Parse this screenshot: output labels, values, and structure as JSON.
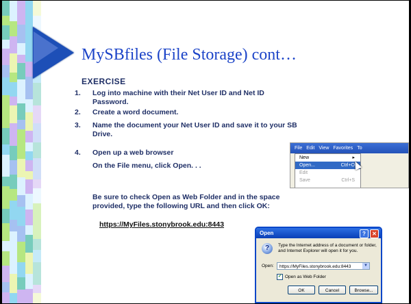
{
  "slide": {
    "title": "MySBfiles (File Storage) cont…",
    "exercise_heading": "EXERCISE",
    "steps": [
      {
        "num": "1.",
        "text": [
          "Log into machine with their Net User ID and Net ID",
          "Password."
        ]
      },
      {
        "num": "2.",
        "text": [
          "Create a word document."
        ]
      },
      {
        "num": "3.",
        "text": [
          "Name the document your Net User ID and save it to your SB",
          "Drive."
        ]
      },
      {
        "num": "4.",
        "text": [
          "Open up a web browser",
          "On the File menu, click Open. . ."
        ]
      }
    ],
    "note_lines": [
      "Be sure to check Open as Web Folder and in the space",
      "provided, type the following URL and then click OK:"
    ],
    "url": "https://MyFiles.stonybrook.edu:8443"
  },
  "menu_screenshot": {
    "menubar": [
      "File",
      "Edit",
      "View",
      "Favorites",
      "To"
    ],
    "items": [
      {
        "label": "New",
        "shortcut": "▸",
        "state": "normal"
      },
      {
        "label": "Open...",
        "shortcut": "Ctrl+O",
        "state": "selected"
      },
      {
        "label": "Edit",
        "shortcut": "",
        "state": "disabled"
      },
      {
        "label": "Save",
        "shortcut": "Ctrl+S",
        "state": "disabled"
      }
    ]
  },
  "open_dialog": {
    "title": "Open",
    "help_glyph": "?",
    "close_glyph": "✕",
    "message": "Type the Internet address of a document or folder, and Internet Explorer will open it for you.",
    "open_label": "Open:",
    "open_value": "https://MyFiles.stonybrook.edu:8443",
    "checkbox_label": "Open as Web Folder",
    "checkbox_checked": true,
    "buttons": {
      "ok": "OK",
      "cancel": "Cancel",
      "browse": "Browse..."
    }
  },
  "colors": {
    "title": "#1c44c8",
    "body_text": "#1f2f66",
    "arrow": "#1d4fb7",
    "stripe_palette": [
      "#7fd0ef",
      "#a9e36b",
      "#c6a8ee",
      "#5fc3b0",
      "#e9f3a6",
      "#97b6ef",
      "#d6f0ff"
    ]
  }
}
